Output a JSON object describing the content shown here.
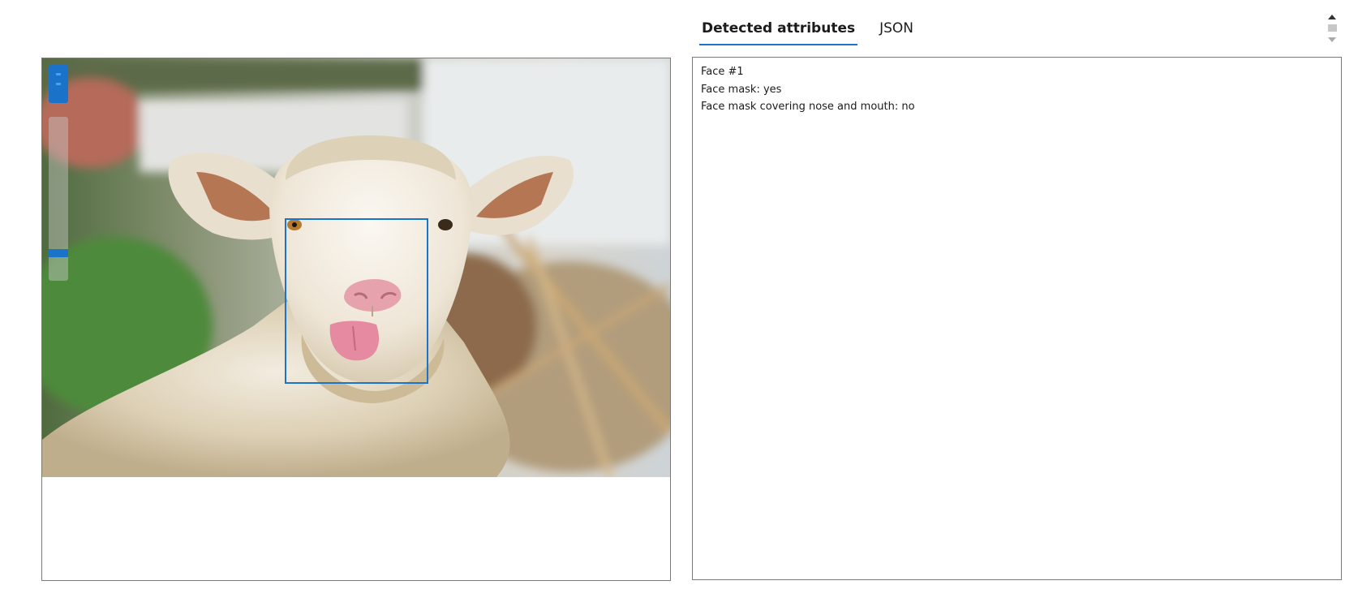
{
  "tabs": [
    {
      "label": "Detected attributes",
      "active": true
    },
    {
      "label": "JSON",
      "active": false
    }
  ],
  "image": {
    "subject": "sheep-photo",
    "zoom_level": 0.15
  },
  "results": {
    "face_label": "Face #1",
    "mask_line": "Face mask: yes",
    "cover_line": "Face mask covering nose and mouth: no"
  },
  "colors": {
    "accent": "#1b74c9",
    "zoom_control": "#1a73c8",
    "border": "#7a7a7a"
  }
}
